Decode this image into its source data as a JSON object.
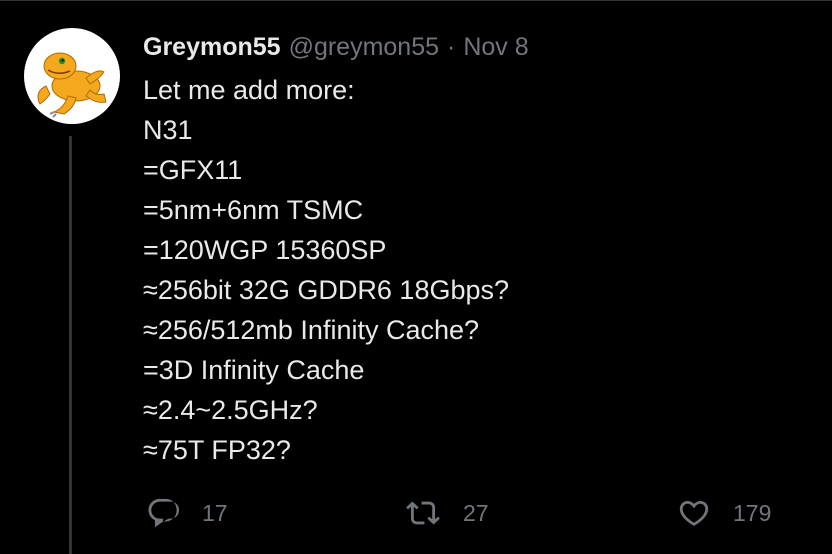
{
  "tweet": {
    "author": {
      "display_name": "Greymon55",
      "handle": "@greymon55",
      "avatar_icon": "agumon-avatar-icon"
    },
    "separator": "·",
    "date": "Nov 8",
    "lines": [
      "Let me add more:",
      "N31",
      "=GFX11",
      "=5nm+6nm TSMC",
      "=120WGP 15360SP",
      "≈256bit 32G GDDR6 18Gbps?",
      "≈256/512mb Infinity Cache?",
      "=3D Infinity Cache",
      "≈2.4~2.5GHz?",
      "≈75T FP32?"
    ],
    "actions": {
      "reply": {
        "icon": "reply-icon",
        "count": "17"
      },
      "retweet": {
        "icon": "retweet-icon",
        "count": "27"
      },
      "like": {
        "icon": "heart-icon",
        "count": "179"
      }
    }
  },
  "colors": {
    "background": "#000000",
    "text_primary": "#e7e9ea",
    "text_secondary": "#71767b",
    "thread_line": "#333639",
    "avatar_character": "#f4a81d"
  }
}
